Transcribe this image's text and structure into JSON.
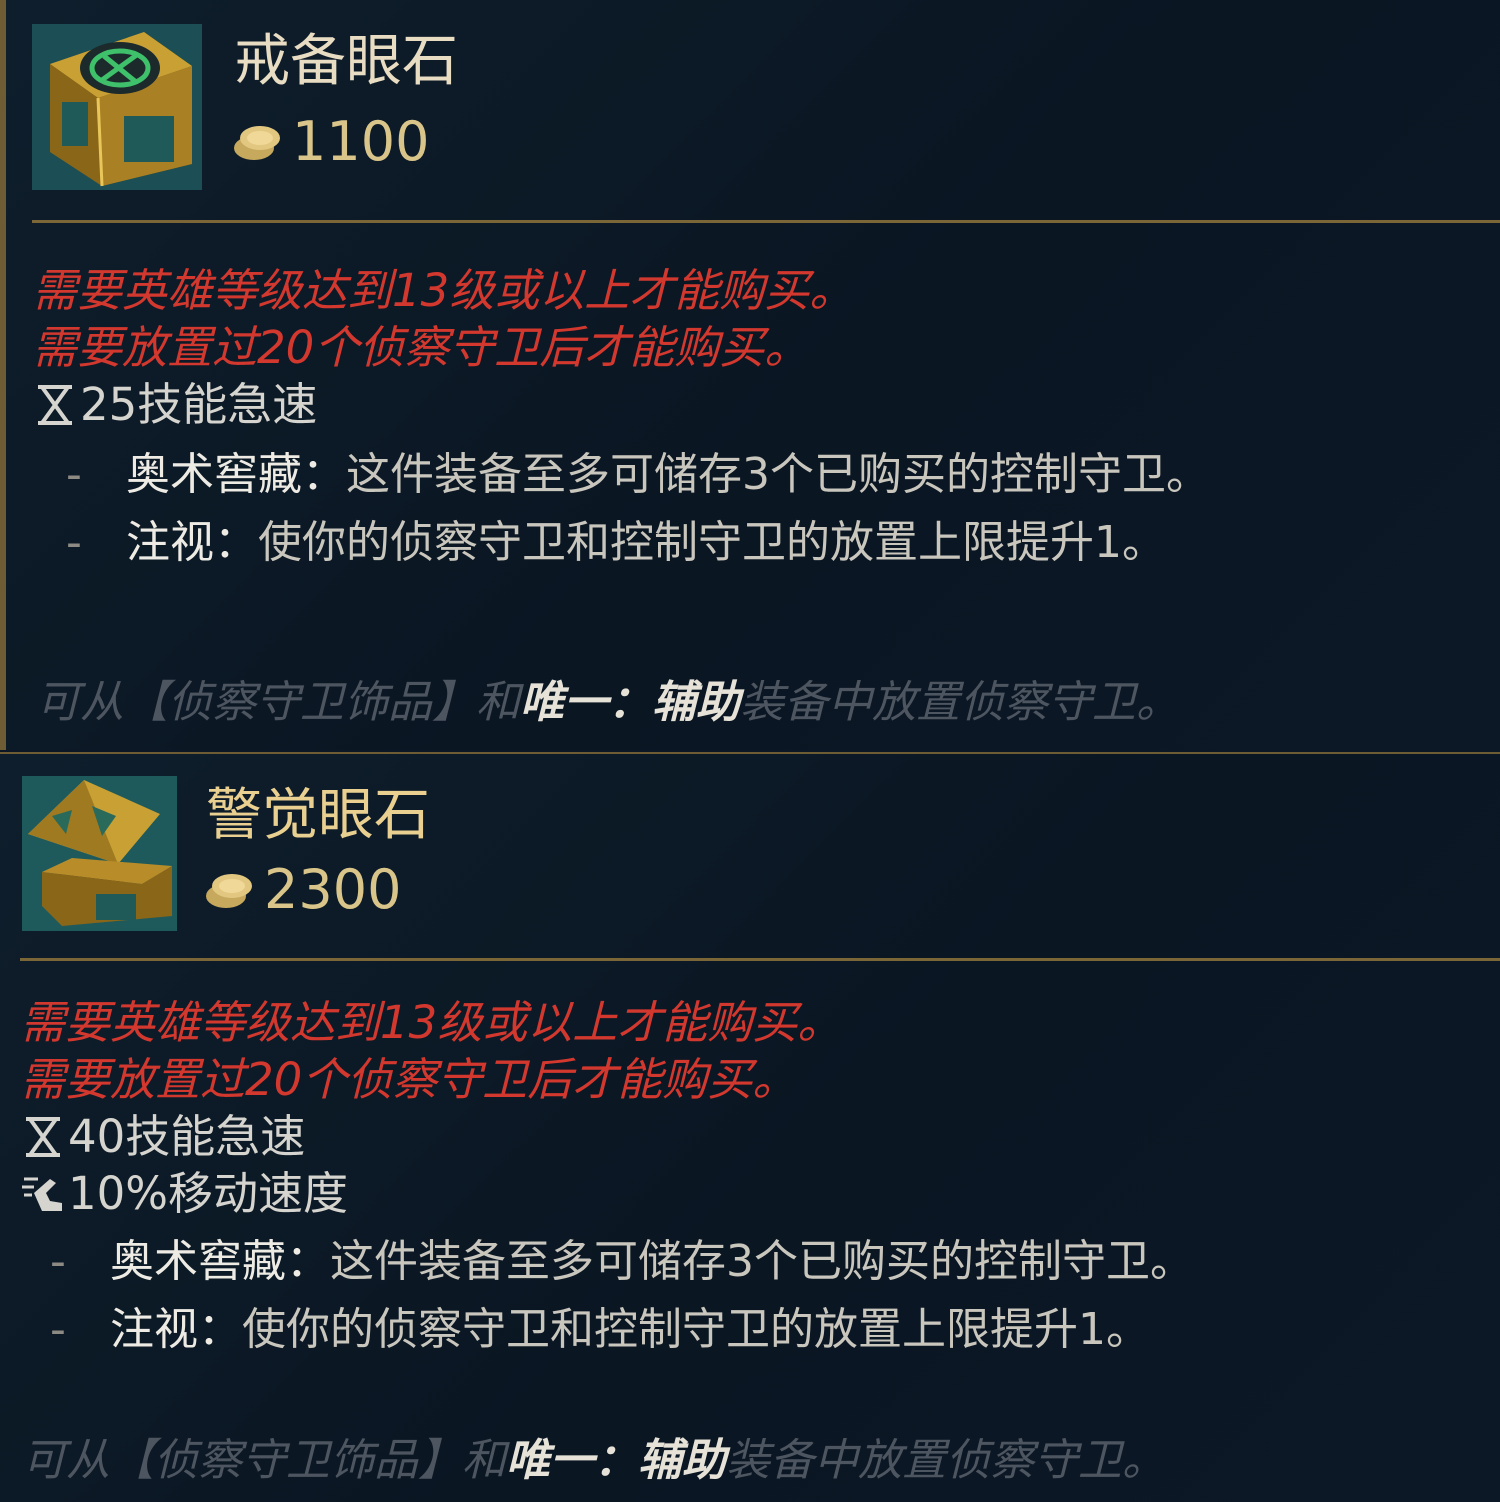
{
  "items": [
    {
      "name": "戒备眼石",
      "cost": "1100",
      "requirements": [
        "需要英雄等级达到13级或以上才能购买。",
        "需要放置过20个侦察守卫后才能购买。"
      ],
      "stats": [
        {
          "icon": "hourglass-icon",
          "text": "25技能急速"
        }
      ],
      "passives": [
        {
          "dash": "-",
          "name": "奥术窖藏：",
          "text": "这件装备至多可储存3个已购买的控制守卫。"
        },
        {
          "dash": "-",
          "name": "注视：",
          "text": "使你的侦察守卫和控制守卫的放置上限提升1。"
        }
      ],
      "footer": {
        "pre": "可从【侦察守卫饰品】和",
        "hl1": "唯一：",
        "hl2": "辅助",
        "post": "装备中放置侦察守卫。"
      }
    },
    {
      "name": "警觉眼石",
      "cost": "2300",
      "requirements": [
        "需要英雄等级达到13级或以上才能购买。",
        "需要放置过20个侦察守卫后才能购买。"
      ],
      "stats": [
        {
          "icon": "hourglass-icon",
          "text": "40技能急速"
        },
        {
          "icon": "boot-icon",
          "text": "10%移动速度"
        }
      ],
      "passives": [
        {
          "dash": "-",
          "name": "奥术窖藏：",
          "text": "这件装备至多可储存3个已购买的控制守卫。"
        },
        {
          "dash": "-",
          "name": "注视：",
          "text": "使你的侦察守卫和控制守卫的放置上限提升1。"
        }
      ],
      "footer": {
        "pre": "可从【侦察守卫饰品】和",
        "hl1": "唯一：",
        "hl2": "辅助",
        "post": "装备中放置侦察守卫。"
      }
    }
  ],
  "colors": {
    "gold": "#e9cf90",
    "requirement": "#d3382f",
    "divider": "#7a6636"
  },
  "icons": {
    "coin": "gold-coin-icon",
    "item1": "watchful-wardstone-icon",
    "item2": "vigilant-wardstone-icon"
  }
}
